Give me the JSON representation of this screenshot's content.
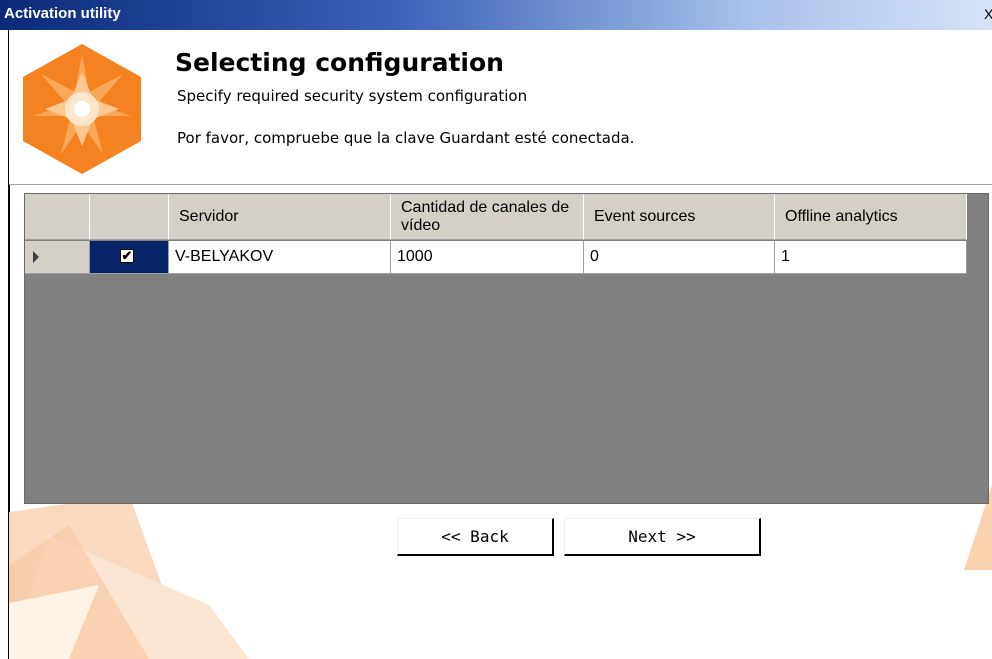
{
  "window": {
    "title": "Activation utility",
    "close_glyph": "X"
  },
  "header": {
    "title": "Selecting configuration",
    "subtitle": "Specify required security system configuration",
    "note": "Por favor, compruebe que la clave Guardant esté conectada."
  },
  "table": {
    "columns": [
      "Servidor",
      "Cantidad de canales de vídeo",
      "Event sources",
      "Offline analytics"
    ],
    "rows": [
      {
        "selected": true,
        "server": "V-BELYAKOV",
        "video_channels": "1000",
        "event_sources": "0",
        "offline_analytics": "1"
      }
    ]
  },
  "buttons": {
    "back": "<< Back",
    "next": "Next >>"
  },
  "colors": {
    "accent": "#f58220",
    "selection": "#0a246a",
    "grid_bg": "#808080",
    "header_bg": "#d4d0c8"
  },
  "icons": {
    "logo": "star-hexagon-logo-icon",
    "row_pointer": "row-pointer-icon",
    "checkbox": "checkbox-checked-icon"
  }
}
